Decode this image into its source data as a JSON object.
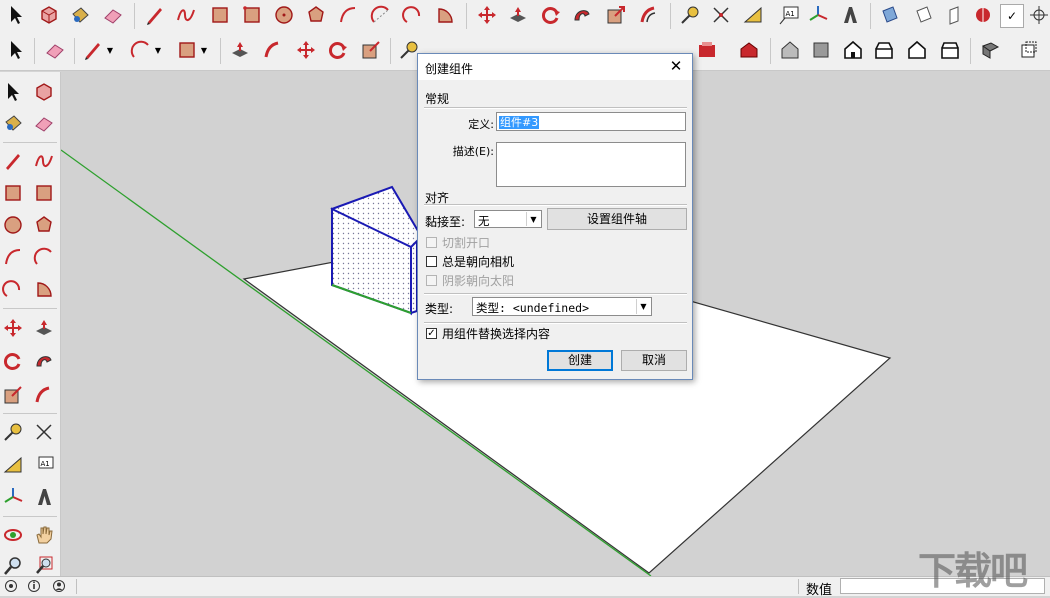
{
  "dialog": {
    "title": "创建组件",
    "close_glyph": "✕",
    "general_group": "常规",
    "definition_label": "定义:",
    "definition_value": "组件#3",
    "description_label": "描述(E):",
    "description_value": "",
    "align_group": "对齐",
    "glue_label": "黏接至:",
    "glue_value": "无",
    "set_axes_button": "设置组件轴",
    "cut_opening_label": "切割开口",
    "cut_opening_checked": false,
    "always_face_camera_label": "总是朝向相机",
    "always_face_camera_checked": false,
    "shadows_face_sun_label": "阴影朝向太阳",
    "shadows_face_sun_checked": false,
    "type_label": "类型:",
    "type_value": "类型: <undefined>",
    "replace_selection_label": "用组件替换选择内容",
    "replace_selection_checked": true,
    "create_button": "创建",
    "cancel_button": "取消"
  },
  "statusbar": {
    "measurements_label": "数值",
    "measurements_value": ""
  },
  "watermark": "下载吧",
  "colors": {
    "accent_red": "#c8282d",
    "axis_green": "#2ea02e",
    "box_edge": "#1a1ab4",
    "dialog_border": "#6a8ab8",
    "selection_blue": "#3399ff"
  },
  "toolbar_icons": [
    "select-icon",
    "make-component-icon",
    "paint-bucket-icon",
    "eraser-icon",
    "pencil-icon",
    "freehand-icon",
    "rectangle-icon",
    "rotated-rectangle-icon",
    "circle-icon",
    "polygon-icon",
    "arc-icon",
    "two-point-arc-icon",
    "three-point-arc-icon",
    "pie-icon",
    "move-icon",
    "push-pull-icon",
    "rotate-icon",
    "follow-me-icon",
    "scale-icon",
    "offset-icon",
    "tape-measure-icon",
    "dimension-icon",
    "protractor-icon",
    "text-icon",
    "axes-icon",
    "3d-text-icon",
    "section-plane-icon",
    "style-icon",
    "house-icon",
    "warehouse-icon"
  ]
}
